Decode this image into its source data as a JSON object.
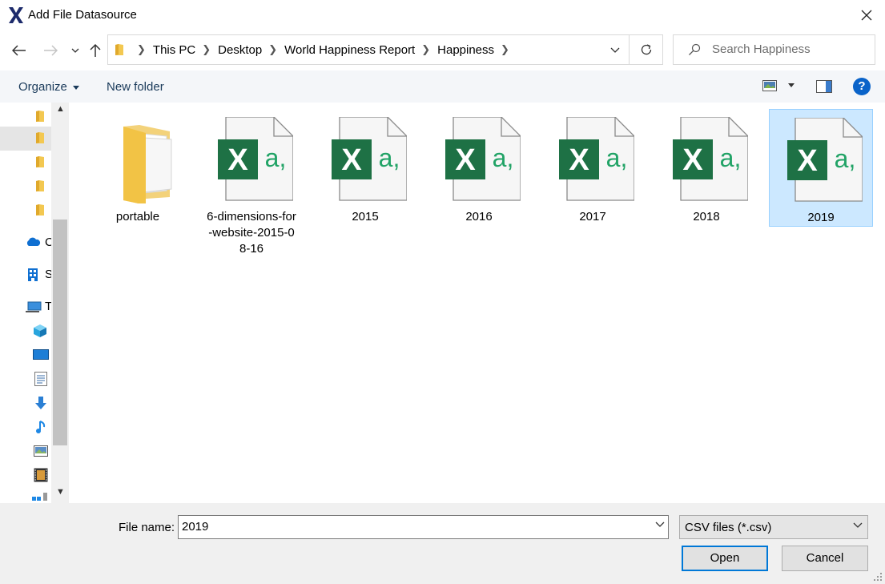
{
  "window": {
    "title": "Add File Datasource",
    "logo_icon": "x-logo-icon",
    "close_icon": "close-icon"
  },
  "nav": {
    "back_icon": "back-arrow-icon",
    "forward_icon": "forward-arrow-icon",
    "recent_icon": "chevron-down-icon",
    "up_icon": "up-arrow-icon",
    "breadcrumb": [
      "This PC",
      "Desktop",
      "World Happiness Report",
      "Happiness"
    ],
    "refresh_icon": "refresh-icon",
    "search_placeholder": "Search Happiness"
  },
  "toolbar": {
    "organize_label": "Organize",
    "new_folder_label": "New folder",
    "view_icon": "view-options-icon",
    "pane_icon": "preview-pane-icon",
    "help_label": "?"
  },
  "sidebar": {
    "items": [
      {
        "icon": "folder-icon",
        "label": ""
      },
      {
        "icon": "folder-icon",
        "label": "",
        "selected": true
      },
      {
        "icon": "folder-icon",
        "label": ""
      },
      {
        "icon": "folder-icon",
        "label": ""
      },
      {
        "icon": "folder-icon",
        "label": ""
      },
      {
        "icon": "onedrive-icon",
        "label": "C"
      },
      {
        "icon": "building-icon",
        "label": "S"
      },
      {
        "icon": "this-pc-icon",
        "label": "T"
      },
      {
        "icon": "3d-objects-icon",
        "label": ""
      },
      {
        "icon": "desktop-icon",
        "label": ""
      },
      {
        "icon": "documents-icon",
        "label": ""
      },
      {
        "icon": "downloads-icon",
        "label": ""
      },
      {
        "icon": "music-icon",
        "label": ""
      },
      {
        "icon": "pictures-icon",
        "label": ""
      },
      {
        "icon": "videos-icon",
        "label": ""
      },
      {
        "icon": "drive-icon",
        "label": ""
      }
    ]
  },
  "files": [
    {
      "name": "portable",
      "type": "folder"
    },
    {
      "name": "6-dimensions-for-website-2015-08-16",
      "type": "csv",
      "lines": [
        "6-dimensions-for",
        "-website-2015-0",
        "8-16"
      ]
    },
    {
      "name": "2015",
      "type": "csv"
    },
    {
      "name": "2016",
      "type": "csv"
    },
    {
      "name": "2017",
      "type": "csv"
    },
    {
      "name": "2018",
      "type": "csv"
    },
    {
      "name": "2019",
      "type": "csv",
      "selected": true
    }
  ],
  "excel_glyph": {
    "letter": "X",
    "suffix": "a,",
    "color": "#1e7145",
    "accent": "#21a366"
  },
  "footer": {
    "file_name_label": "File name:",
    "file_name_value": "2019",
    "file_type": "CSV files (*.csv)",
    "open_label": "Open",
    "cancel_label": "Cancel"
  },
  "colors": {
    "selection_bg": "#cce8ff",
    "selection_border": "#99d1ff",
    "primary_button_border": "#0078d7",
    "help_blue": "#0a63c9"
  }
}
